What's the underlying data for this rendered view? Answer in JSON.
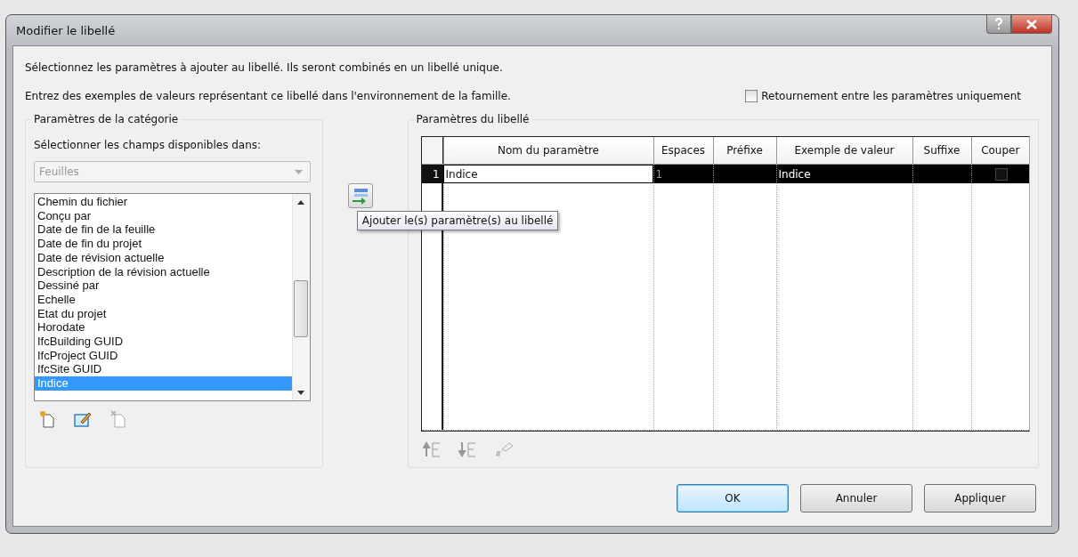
{
  "window": {
    "title": "Modifier le libellé"
  },
  "instructions": [
    "Sélectionnez les paramètres à ajouter au libellé. Ils seront combinés en un libellé unique.",
    "Entrez des exemples de valeurs représentant ce libellé dans l'environnement de la famille."
  ],
  "wrap_option": {
    "label": "Retournement entre les paramètres uniquement",
    "checked": false
  },
  "category_group": {
    "legend": "Paramètres de la catégorie",
    "prompt": "Sélectionner les champs disponibles dans:",
    "dropdown": {
      "value": "Feuilles",
      "disabled": true
    },
    "items": [
      {
        "label": "Chemin du fichier",
        "selected": false
      },
      {
        "label": "Conçu par",
        "selected": false
      },
      {
        "label": "Date de fin de la feuille",
        "selected": false
      },
      {
        "label": "Date de fin du projet",
        "selected": false
      },
      {
        "label": "Date de révision actuelle",
        "selected": false
      },
      {
        "label": "Description de la révision actuelle",
        "selected": false
      },
      {
        "label": "Dessiné par",
        "selected": false
      },
      {
        "label": "Echelle",
        "selected": false
      },
      {
        "label": "Etat du projet",
        "selected": false
      },
      {
        "label": "Horodate",
        "selected": false
      },
      {
        "label": "IfcBuilding GUID",
        "selected": false
      },
      {
        "label": "IfcProject GUID",
        "selected": false
      },
      {
        "label": "IfcSite GUID",
        "selected": false
      },
      {
        "label": "Indice",
        "selected": true
      }
    ]
  },
  "add_button": {
    "tooltip": "Ajouter le(s) paramètre(s) au libellé"
  },
  "label_group": {
    "legend": "Paramètres du libellé",
    "columns": [
      "Nom du paramètre",
      "Espaces",
      "Préfixe",
      "Exemple de valeur",
      "Suffixe",
      "Couper"
    ],
    "rows": [
      {
        "number": "1",
        "name": "Indice",
        "spaces": "1",
        "prefix": "",
        "sample": "Indice",
        "suffix": "",
        "wrap": false,
        "selected": true
      }
    ]
  },
  "buttons": [
    {
      "label": "OK",
      "default": true
    },
    {
      "label": "Annuler",
      "default": false
    },
    {
      "label": "Appliquer",
      "default": false
    }
  ]
}
